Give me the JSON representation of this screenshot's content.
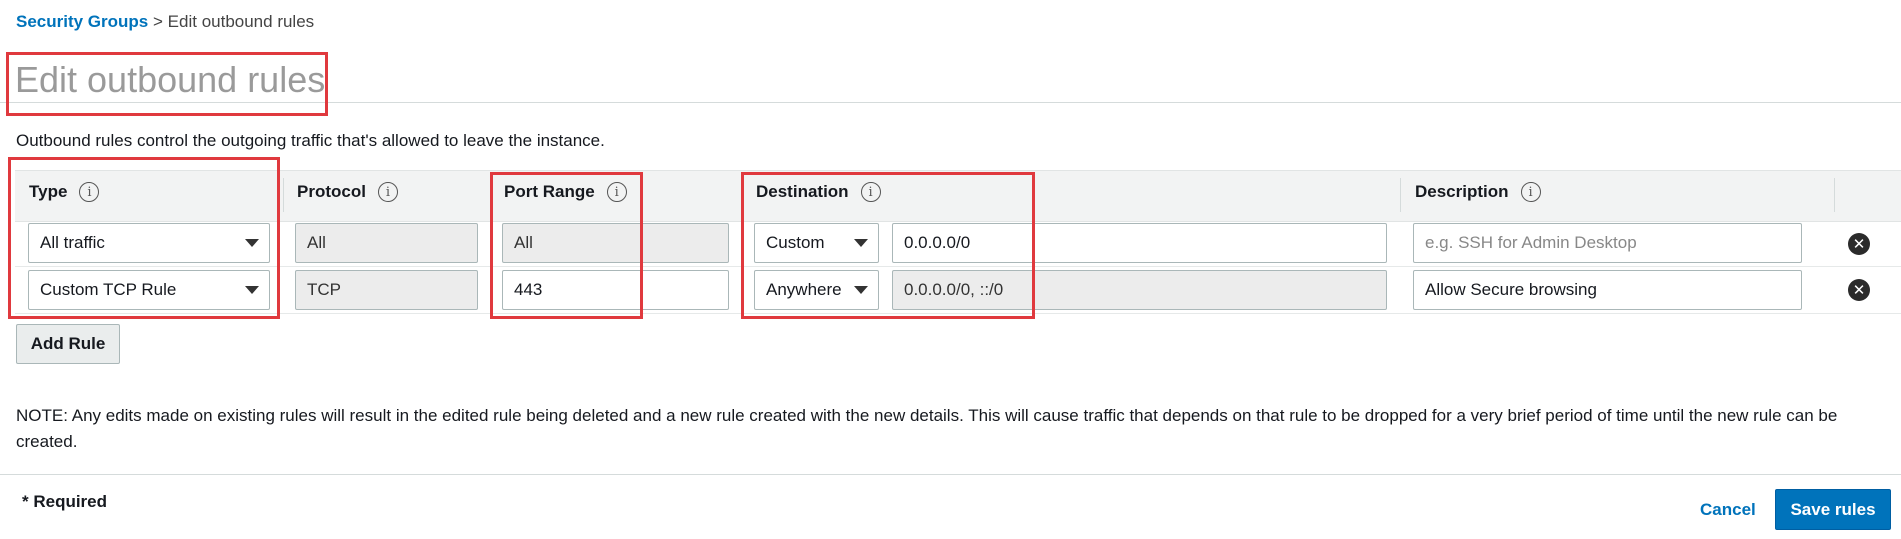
{
  "breadcrumb": {
    "parent": "Security Groups",
    "separator": ">",
    "current": "Edit outbound rules"
  },
  "page": {
    "title": "Edit outbound rules",
    "subtitle": "Outbound rules control the outgoing traffic that's allowed to leave the instance."
  },
  "table": {
    "columns": {
      "type": "Type",
      "protocol": "Protocol",
      "port_range": "Port Range",
      "destination": "Destination",
      "description": "Description"
    },
    "info_icon": "i",
    "rows": [
      {
        "type": "All traffic",
        "protocol": "All",
        "port_range": "All",
        "destination_mode": "Custom",
        "destination_value": "0.0.0.0/0",
        "description_placeholder": "e.g. SSH for Admin Desktop",
        "description_value": ""
      },
      {
        "type": "Custom TCP Rule",
        "protocol": "TCP",
        "port_range": "443",
        "destination_mode": "Anywhere",
        "destination_value": "0.0.0.0/0, ::/0",
        "description_placeholder": "",
        "description_value": "Allow Secure browsing"
      }
    ],
    "remove_icon": "✕"
  },
  "actions": {
    "add_rule": "Add Rule",
    "cancel": "Cancel",
    "save": "Save rules"
  },
  "note": "NOTE: Any edits made on existing rules will result in the edited rule being deleted and a new rule created with the new details. This will cause traffic that depends on that rule to be dropped for a very brief period of time until the new rule can be created.",
  "footer": {
    "required": "* Required"
  },
  "colors": {
    "link": "#0073bb",
    "primary": "#0073bb",
    "highlight": "#e0393e"
  }
}
